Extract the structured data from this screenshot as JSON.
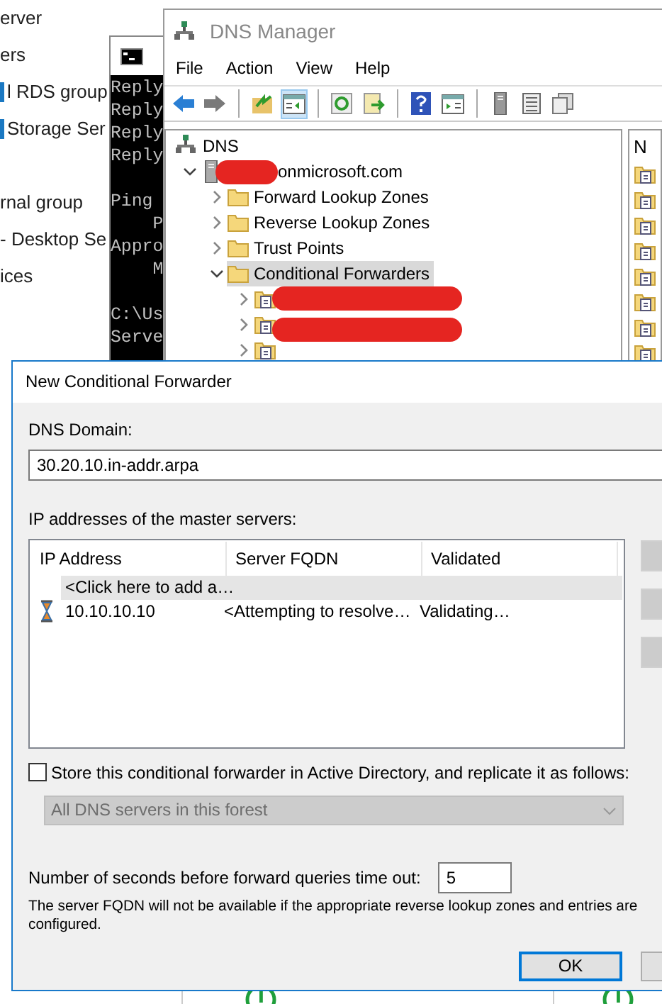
{
  "background_window": {
    "items": [
      {
        "kind": "plain",
        "label": "erver"
      },
      {
        "kind": "plain",
        "label": "ers"
      },
      {
        "kind": "tagged",
        "label": "l RDS group"
      },
      {
        "kind": "tagged",
        "label": "Storage Ser"
      },
      {
        "kind": "blank"
      },
      {
        "kind": "plain",
        "label": "rnal group"
      },
      {
        "kind": "plain",
        "label": "- Desktop Se"
      },
      {
        "kind": "plain",
        "label": "ices"
      }
    ],
    "tiles": [
      {
        "kind": "status"
      },
      {
        "kind": "status"
      }
    ]
  },
  "console_window": {
    "lines": [
      {
        "kind": "text",
        "text": "Reply"
      },
      {
        "kind": "text",
        "text": "Reply"
      },
      {
        "kind": "text",
        "text": "Reply"
      },
      {
        "kind": "text",
        "text": "Reply"
      },
      {
        "kind": "blank"
      },
      {
        "kind": "text",
        "text": "Ping"
      },
      {
        "kind": "text",
        "text": "    P"
      },
      {
        "kind": "text",
        "text": "Appro"
      },
      {
        "kind": "text",
        "text": "    M"
      },
      {
        "kind": "blank"
      },
      {
        "kind": "text",
        "text": "C:\\Us"
      },
      {
        "kind": "text",
        "text": "Serve"
      }
    ]
  },
  "dns_manager": {
    "title": "DNS Manager",
    "menu": [
      "File",
      "Action",
      "View",
      "Help"
    ],
    "toolbar": [
      {
        "kind": "back",
        "pressed": false
      },
      {
        "kind": "forward",
        "pressed": false
      },
      {
        "kind": "separator"
      },
      {
        "kind": "up",
        "pressed": false
      },
      {
        "kind": "tree",
        "pressed": true
      },
      {
        "kind": "separator"
      },
      {
        "kind": "refresh",
        "pressed": false
      },
      {
        "kind": "export",
        "pressed": false
      },
      {
        "kind": "separator"
      },
      {
        "kind": "help",
        "pressed": false
      },
      {
        "kind": "pane",
        "pressed": false
      },
      {
        "kind": "separator"
      },
      {
        "kind": "server",
        "pressed": false
      },
      {
        "kind": "list",
        "pressed": false
      },
      {
        "kind": "copy",
        "pressed": false
      }
    ],
    "tree": [
      {
        "kind": "root",
        "label": "DNS",
        "selected": false,
        "children": [
          {
            "kind": "server",
            "label": "onmicrosoft.com",
            "redacted": true,
            "expanded": true,
            "selected": false,
            "children": [
              {
                "kind": "folder",
                "label": "Forward Lookup Zones",
                "expanded": false,
                "selected": false
              },
              {
                "kind": "folder",
                "label": "Reverse Lookup Zones",
                "expanded": false,
                "selected": false
              },
              {
                "kind": "folder",
                "label": "Trust Points",
                "expanded": false,
                "selected": false
              },
              {
                "kind": "folder",
                "label": "Conditional Forwarders",
                "expanded": true,
                "selected": true,
                "children": [
                  {
                    "kind": "forwarder",
                    "redacted": true,
                    "expanded": false,
                    "selected": false
                  },
                  {
                    "kind": "forwarder",
                    "redacted": true,
                    "expanded": false,
                    "selected": false
                  },
                  {
                    "kind": "forwarder",
                    "redacted": false,
                    "expanded": false,
                    "selected": false
                  }
                ]
              }
            ]
          }
        ]
      }
    ],
    "details": {
      "column_1": "N",
      "rows": [
        {
          "kind": "forwarder"
        },
        {
          "kind": "forwarder"
        },
        {
          "kind": "forwarder"
        },
        {
          "kind": "forwarder"
        },
        {
          "kind": "forwarder"
        },
        {
          "kind": "forwarder"
        },
        {
          "kind": "forwarder"
        },
        {
          "kind": "forwarder"
        }
      ]
    }
  },
  "dialog": {
    "title": "New Conditional Forwarder",
    "domain_label": "DNS Domain:",
    "domain_value": "30.20.10.in-addr.arpa",
    "servers_label": "IP addresses of the master servers:",
    "columns": [
      "IP Address",
      "Server FQDN",
      "Validated"
    ],
    "rows": [
      {
        "kind": "add",
        "ip": "<Click here to add a…",
        "selected": true
      },
      {
        "kind": "validating",
        "ip": "10.10.10.10",
        "fqdn": "<Attempting to resolve…",
        "validated": "Validating…",
        "selected": false
      }
    ],
    "side_buttons": [
      {
        "disabled": true
      },
      {
        "disabled": true
      },
      {
        "disabled": true
      }
    ],
    "store": {
      "label": "Store this conditional forwarder in Active Directory, and replicate it as follows:",
      "checked": false
    },
    "replication": {
      "value": "All DNS servers in this forest",
      "disabled": true
    },
    "timeout": {
      "label": "Number of seconds before forward queries time out:",
      "value": "5"
    },
    "note_lines": [
      "The server FQDN will not be available if the appropriate reverse lookup zones and entries are",
      "configured."
    ],
    "buttons": [
      {
        "label": "OK",
        "default": true
      },
      {
        "default": false
      }
    ]
  }
}
